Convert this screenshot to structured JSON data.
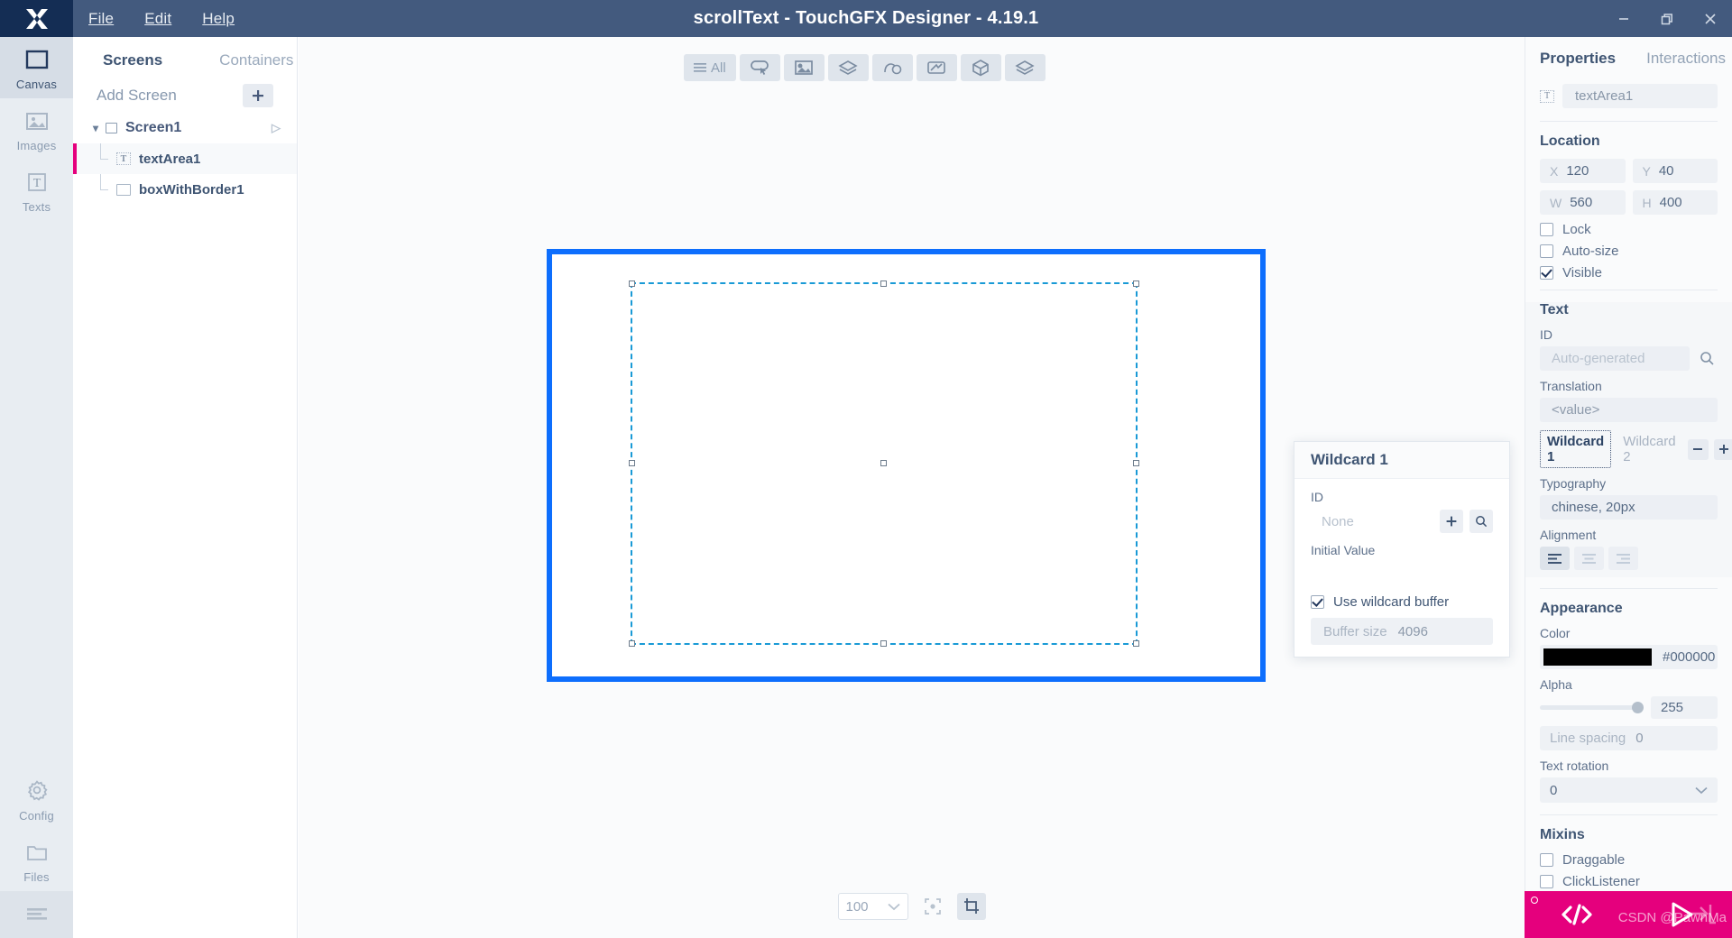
{
  "titlebar": {
    "title": "scrollText - TouchGFX Designer - 4.19.1",
    "menus": [
      "File",
      "Edit",
      "Help"
    ],
    "window_controls": [
      "minimize-icon",
      "restore-icon",
      "close-icon"
    ],
    "logo": "touchgfx-logo-icon"
  },
  "rail": {
    "items": [
      {
        "label": "Canvas",
        "icon": "canvas-icon",
        "active": true
      },
      {
        "label": "Images",
        "icon": "images-icon",
        "active": false
      },
      {
        "label": "Texts",
        "icon": "texts-icon",
        "active": false
      },
      {
        "label": "Config",
        "icon": "gear-icon",
        "active": false
      },
      {
        "label": "Files",
        "icon": "folder-icon",
        "active": false
      }
    ],
    "bottom_icon": "hamburger-menu-icon"
  },
  "explorer": {
    "tabs": [
      {
        "label": "Screens",
        "active": true
      },
      {
        "label": "Containers",
        "active": false
      }
    ],
    "add_screen_label": "Add Screen",
    "add_button_icon": "plus-icon",
    "tree": [
      {
        "label": "Screen1",
        "type": "screen",
        "expanded": true,
        "icon": "screen-icon",
        "play_icon": "play-triangle-icon"
      },
      {
        "label": "textArea1",
        "type": "textarea",
        "icon": "text-widget-icon",
        "selected": true
      },
      {
        "label": "boxWithBorder1",
        "type": "box",
        "icon": "box-widget-icon",
        "selected": false
      }
    ]
  },
  "widget_toolbar": {
    "buttons": [
      {
        "label": "All",
        "icon": "hamburger-icon"
      },
      {
        "label": "",
        "icon": "button-widget-icon"
      },
      {
        "label": "",
        "icon": "image-widget-icon"
      },
      {
        "label": "",
        "icon": "container-layers-icon"
      },
      {
        "label": "",
        "icon": "shape-curve-icon"
      },
      {
        "label": "",
        "icon": "gauge-widget-icon"
      },
      {
        "label": "",
        "icon": "cube-3d-icon"
      },
      {
        "label": "",
        "icon": "layers-stack-icon"
      }
    ]
  },
  "canvas": {
    "border_color": "#0d6efd",
    "selection_color": "#199ad6",
    "zoom_value": "100",
    "zoom_chevron": "chevron-down-icon",
    "fit_icon": "fit-to-screen-icon",
    "crop_icon": "crop-icon"
  },
  "wildcard_popup": {
    "title": "Wildcard 1",
    "id_label": "ID",
    "id_placeholder": "None",
    "add_icon": "plus-icon",
    "search_icon": "search-icon",
    "initial_value_label": "Initial Value",
    "initial_value": "",
    "use_buffer_label": "Use wildcard buffer",
    "use_buffer_checked": true,
    "buffer_size_label": "Buffer size",
    "buffer_size_value": "4096"
  },
  "properties": {
    "tabs": [
      {
        "label": "Properties",
        "active": true
      },
      {
        "label": "Interactions",
        "active": false
      }
    ],
    "widget_icon": "text-widget-icon",
    "widget_name": "textArea1",
    "location": {
      "title": "Location",
      "x_key": "X",
      "x_value": "120",
      "y_key": "Y",
      "y_value": "40",
      "w_key": "W",
      "w_value": "560",
      "h_key": "H",
      "h_value": "400"
    },
    "flags": [
      {
        "label": "Lock",
        "checked": false
      },
      {
        "label": "Auto-size",
        "checked": false
      },
      {
        "label": "Visible",
        "checked": true
      }
    ],
    "text": {
      "title": "Text",
      "id_label": "ID",
      "id_placeholder": "Auto-generated",
      "search_icon": "search-icon",
      "translation_label": "Translation",
      "translation_value": "<value>",
      "wildcards": [
        {
          "label": "Wildcard 1",
          "active": true
        },
        {
          "label": "Wildcard 2",
          "active": false
        }
      ],
      "minus_icon": "minus-icon",
      "plus_icon": "plus-icon",
      "typography_label": "Typography",
      "typography_value": "chinese, 20px",
      "alignment_label": "Alignment",
      "alignments": [
        {
          "icon": "align-left-icon",
          "active": true
        },
        {
          "icon": "align-center-icon",
          "active": false
        },
        {
          "icon": "align-right-icon",
          "active": false
        }
      ]
    },
    "appearance": {
      "title": "Appearance",
      "color_label": "Color",
      "color_hex": "#000000",
      "alpha_label": "Alpha",
      "alpha_value": "255",
      "line_spacing_label": "Line spacing",
      "line_spacing_value": "0",
      "text_rotation_label": "Text rotation",
      "text_rotation_value": "0",
      "rotation_chevron": "chevron-down-icon"
    },
    "mixins": {
      "title": "Mixins",
      "items": [
        {
          "label": "Draggable",
          "checked": false
        },
        {
          "label": "ClickListener",
          "checked": false
        }
      ]
    }
  },
  "action_bar": {
    "code_icon": "code-brackets-icon",
    "run_icon": "play-run-icon",
    "accent_color": "#e5007d",
    "export_icon": "export-arrow-icon"
  },
  "watermark": "CSDN @PawnMa"
}
